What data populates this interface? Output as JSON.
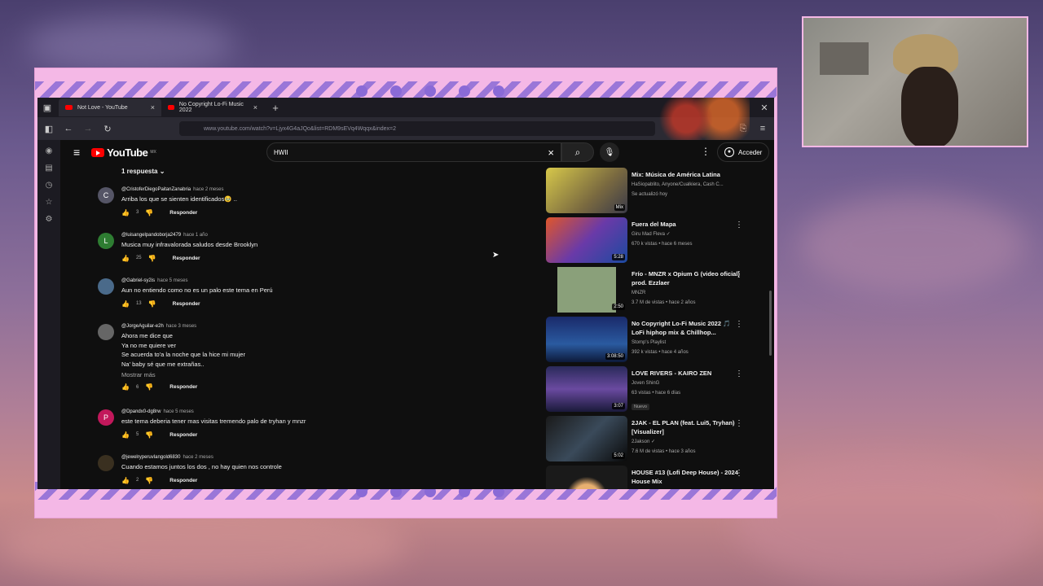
{
  "browser": {
    "tabs": [
      {
        "label": "Not Love - YouTube"
      },
      {
        "label": "No Copyright Lo-Fi Music 2022"
      }
    ],
    "url": "www.youtube.com/watch?v=Ljyx4G4aJQo&list=RDM9sEVq4Wqqx&index=2"
  },
  "youtube": {
    "logo": "YouTube",
    "region": "MX",
    "search_value": "HWII",
    "signin_label": "Acceder"
  },
  "comments": {
    "replies_toggle": "1 respuesta",
    "reply_label": "Responder",
    "more_label": "Mostrar más",
    "items": [
      {
        "initial": "C",
        "author": "@CristoferDiegoPaitanZanabria",
        "time": "hace 2 meses",
        "lines": [
          "Arriba los que se sienten identificados🥹 .."
        ],
        "likes": "3"
      },
      {
        "initial": "L",
        "author": "@luisangelpandoborja2479",
        "time": "hace 1 año",
        "lines": [
          "Musica muy infravalorada saludos desde Brooklyn"
        ],
        "likes": "25"
      },
      {
        "initial": "",
        "author": "@Gabriel-sy2is",
        "time": "hace 5 meses",
        "lines": [
          "Aun no entiendo como no es un palo este tema en Perú"
        ],
        "likes": "13"
      },
      {
        "initial": "",
        "author": "@JorgeAguilar-e2h",
        "time": "hace 3 meses",
        "lines": [
          "Ahora me dice que",
          "Ya no me quiere ver",
          "Se acuerda to'a la noche que la hice mi mujer",
          "Na' baby sé que me extrañas.."
        ],
        "likes": "6"
      },
      {
        "initial": "P",
        "author": "@Dpandx0-dg8rw",
        "time": "hace 5 meses",
        "lines": [
          "este tema deberia tener  mas visitas tremendo palo de tryhan y mnzr"
        ],
        "likes": "5"
      },
      {
        "initial": "",
        "author": "@jewelryperuvlangold6830",
        "time": "hace 2 meses",
        "lines": [
          "Cuando estamos juntos los dos , no hay quien nos controle"
        ],
        "likes": "2"
      }
    ]
  },
  "recommendations": [
    {
      "title": "Mix: Música de América Latina",
      "meta1": "HaSiopablito, Anyone/Cualkiera, Cash C...",
      "meta2": "Se actualizó hoy",
      "duration": "Mix",
      "badge": ""
    },
    {
      "title": "Fuera del Mapa",
      "meta1": "Giru Mad Fleva ✓",
      "meta2": "670 k vistas • hace 6 meses",
      "duration": "5:28",
      "badge": ""
    },
    {
      "title": "Frío - MNZR x Opium G (video oficial) prod. Ezzlaer",
      "meta1": "MNZR",
      "meta2": "3.7 M de vistas • hace 2 años",
      "duration": "2:50",
      "badge": ""
    },
    {
      "title": "No Copyright Lo-Fi Music 2022 🎵 LoFi hiphop mix & Chillhop...",
      "meta1": "Stomp's Playlist",
      "meta2": "392 k vistas • hace 4 años",
      "duration": "3:08:50",
      "badge": ""
    },
    {
      "title": "LOVE RIVERS  - KAIRO ZEN",
      "meta1": "Joven ShinG",
      "meta2": "63 vistas • hace 6 días",
      "duration": "3:07",
      "badge": "Nuevo"
    },
    {
      "title": "2JAK - EL PLAN (feat. Lui5, Tryhan) [Visualizer]",
      "meta1": "2Jakson ✓",
      "meta2": "7.6 M de vistas • hace 3 años",
      "duration": "5:02",
      "badge": ""
    },
    {
      "title": "HOUSE #13 (Lofi Deep House) - 2024 House Mix",
      "meta1": "",
      "meta2": "",
      "duration": "",
      "badge": ""
    }
  ],
  "colors": {
    "frame_pink": "#f4b8e6",
    "stripe_purple": "#8a6ad6",
    "yt_red": "#ff0000",
    "bg_dark": "#0f0f0f"
  }
}
